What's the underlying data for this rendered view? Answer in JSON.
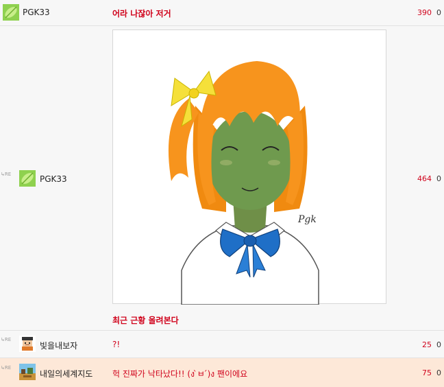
{
  "posts": [
    {
      "nickname": "PGK33",
      "avatar_icon": "green-leaf-icon",
      "title": "어라 나잖아 저거",
      "views": "390",
      "votes": "0"
    },
    {
      "reply_marker": "RE",
      "nickname": "PGK33",
      "avatar_icon": "green-leaf-icon",
      "image_signature": "Pgk",
      "title": "최근 근황 올려본다",
      "views": "464",
      "votes": "0"
    },
    {
      "reply_marker": "RE",
      "nickname": "빛을내보자",
      "avatar_icon": "pixel-character-icon",
      "title": "?!",
      "views": "25",
      "votes": "0"
    },
    {
      "reply_marker": "RE",
      "nickname": "내일의세계지도",
      "avatar_icon": "pixel-landscape-icon",
      "title": "헉 진짜가 낙타났다!! (ง ̀ㅂ ́)ง 팬이에요",
      "views": "75",
      "votes": "0"
    }
  ],
  "colors": {
    "title_red": "#d0021b",
    "highlight_row": "#fde8d8",
    "row_bg": "#f7f7f7"
  }
}
